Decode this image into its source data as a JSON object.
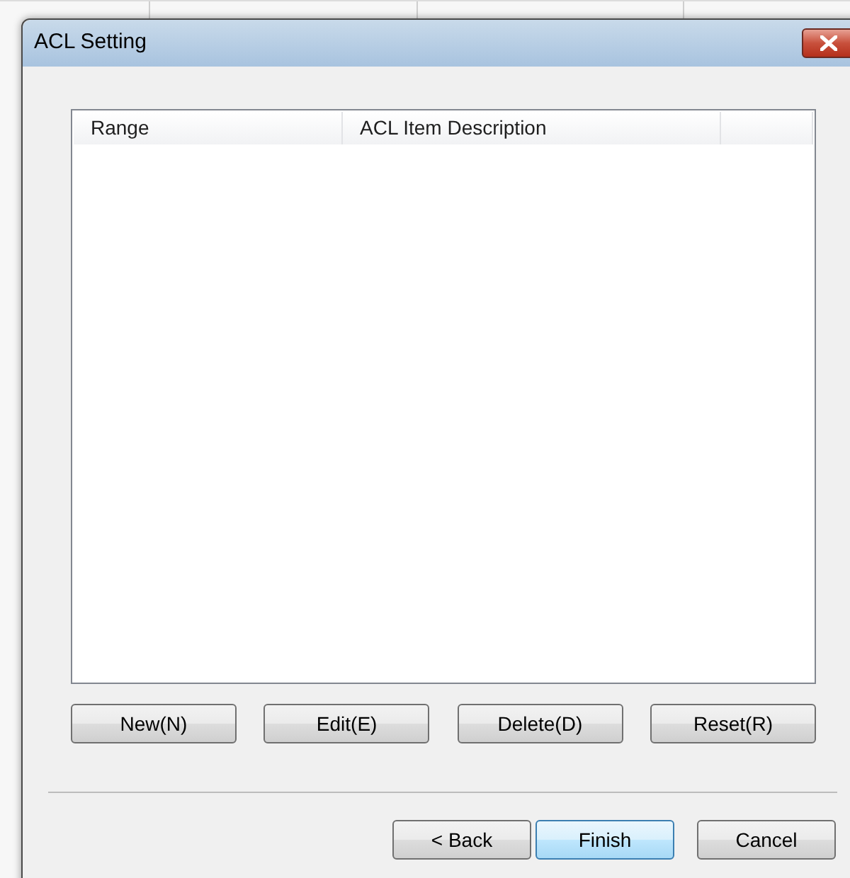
{
  "window": {
    "title": "ACL Setting"
  },
  "table": {
    "columns": [
      "Range",
      "ACL Item Description",
      ""
    ]
  },
  "action_buttons": [
    {
      "label": "New(N)"
    },
    {
      "label": "Edit(E)"
    },
    {
      "label": "Delete(D)"
    },
    {
      "label": "Reset(R)"
    }
  ],
  "nav_buttons": [
    {
      "label": "< Back",
      "default": false
    },
    {
      "label": "Finish",
      "default": true
    },
    {
      "label": "Cancel",
      "default": false
    }
  ]
}
